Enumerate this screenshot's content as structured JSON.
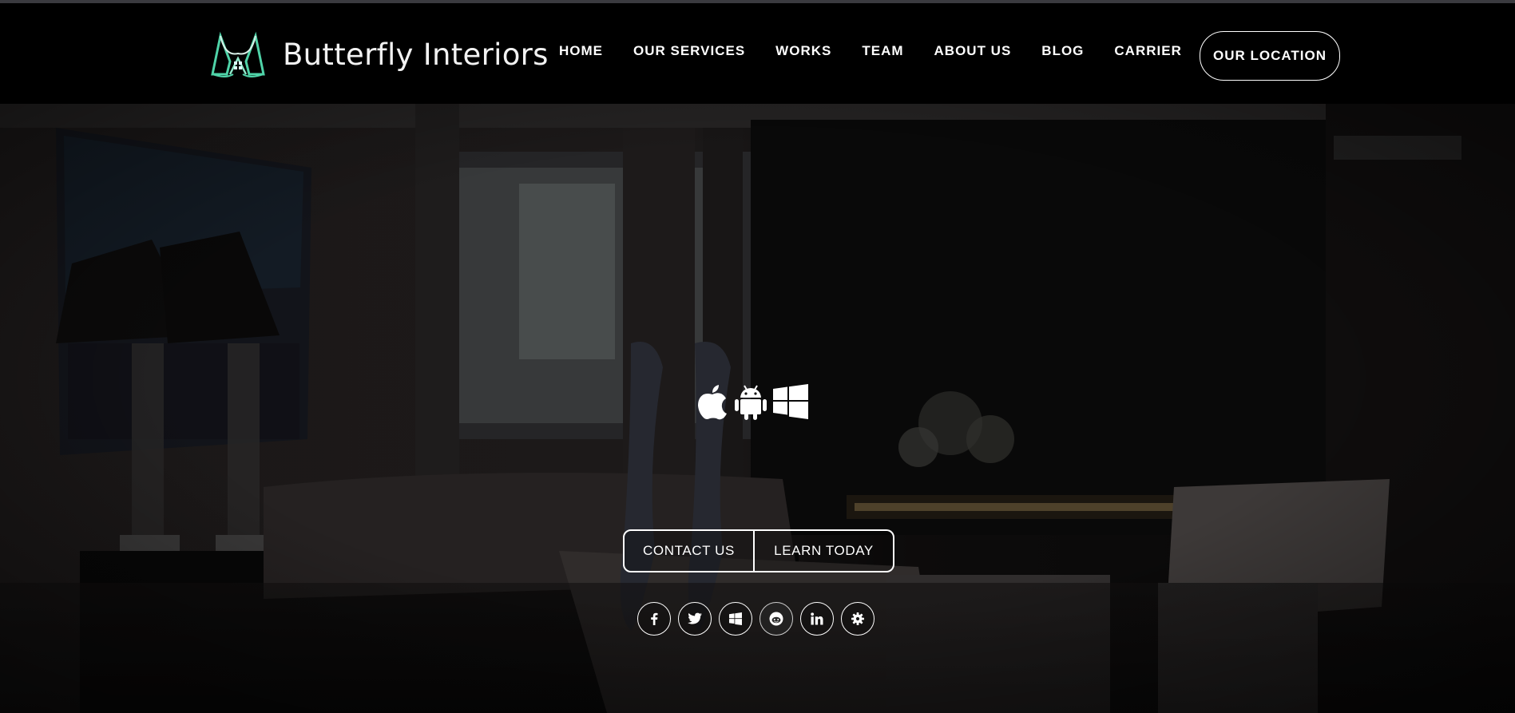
{
  "brand": {
    "name": "Butterfly Interiors",
    "logo_icon": "butterfly-house-logo",
    "logo_color": "#4fd3a8"
  },
  "nav": {
    "items": [
      {
        "label": "HOME"
      },
      {
        "label": "OUR SERVICES"
      },
      {
        "label": "WORKS"
      },
      {
        "label": "TEAM"
      },
      {
        "label": "ABOUT US"
      },
      {
        "label": "BLOG"
      },
      {
        "label": "CARRIER"
      }
    ],
    "location_button": "OUR LOCATION"
  },
  "hero": {
    "background": "dark living room interior photo",
    "platform_icons": [
      "apple-icon",
      "android-icon",
      "windows-icon"
    ],
    "buttons": {
      "contact": "CONTACT US",
      "learn": "LEARN TODAY"
    },
    "social_icons": [
      "facebook-icon",
      "twitter-icon",
      "windows-icon",
      "reddit-icon",
      "linkedin-icon",
      "settings-icon"
    ]
  },
  "colors": {
    "nav_bg": "#000000",
    "text": "#ffffff",
    "accent": "#4fd3a8"
  }
}
